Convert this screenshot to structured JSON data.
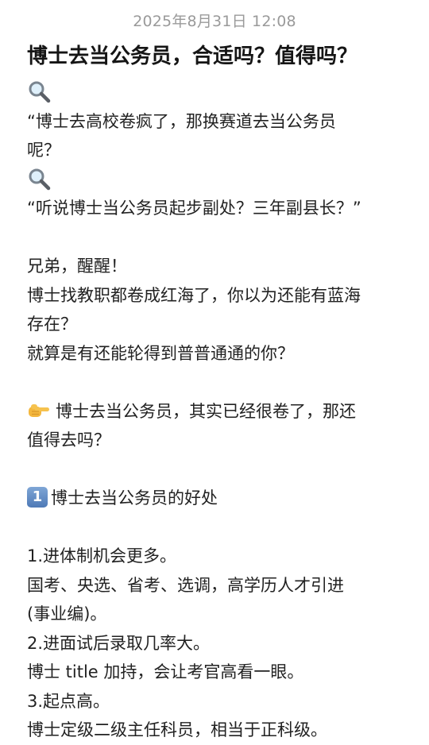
{
  "timestamp": "2025年8月31日 12:08",
  "title": "博士去当公务员，合适吗？值得吗？",
  "icons": {
    "magnifier": "magnifying-glass-icon",
    "pointing_hand": "pointing-hand-icon",
    "keycap_one": "keycap-one-icon",
    "keycap_one_glyph": "1"
  },
  "content": {
    "q1_line1": "“博士去高校卷疯了，那换赛道去当公务员",
    "q1_line2": "呢？",
    "q2": "“听说博士当公务员起步副处？三年副县长？”",
    "wake": "兄弟，醒醒！",
    "para1_line1": "博士找教职都卷成红海了，你以为还能有蓝海",
    "para1_line2": "存在？",
    "para1_line3": "就算是有还能轮得到普普通通的你？",
    "point_line1": "博士去当公务员，其实已经很卷了，那还",
    "point_line2": "值得去吗？",
    "section1_heading": "博士去当公务员的好处",
    "item1": "1.进体制机会更多。",
    "item1_detail_line1": "国考、央选、省考、选调，高学历人才引进",
    "item1_detail_line2": "(事业编)。",
    "item2": "2.进面试后录取几率大。",
    "item2_detail": "博士 title 加持，会让考官高看一眼。",
    "item3": "3.起点高。",
    "item3_detail": "博士定级二级主任科员，相当于正科级。"
  }
}
